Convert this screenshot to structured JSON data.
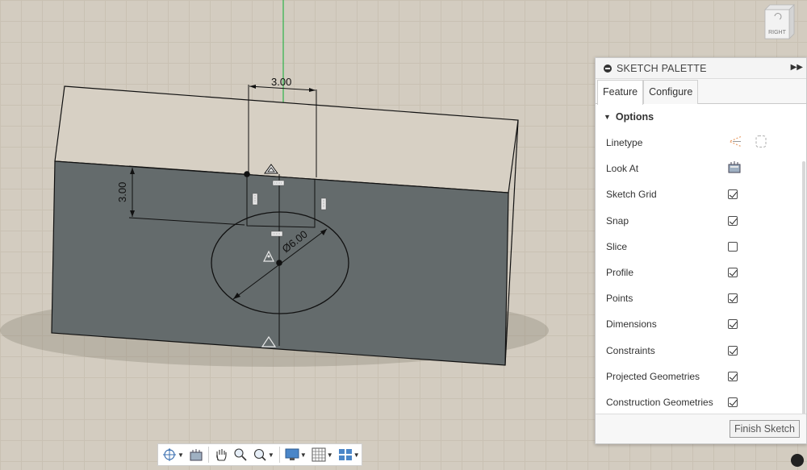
{
  "viewcube": {
    "face_label": "RIGHT"
  },
  "sketch": {
    "dimensions": {
      "width_label": "3.00",
      "height_label": "3.00",
      "diameter_label": "Ø6.00"
    }
  },
  "palette": {
    "title": "SKETCH PALETTE",
    "tabs": [
      {
        "label": "Feature",
        "active": true
      },
      {
        "label": "Configure",
        "active": false
      }
    ],
    "section_title": "Options",
    "options": [
      {
        "label": "Linetype",
        "control": "icons",
        "icons": [
          "construction-line-icon",
          "centerline-icon"
        ]
      },
      {
        "label": "Look At",
        "control": "icon",
        "icons": [
          "look-at-icon"
        ]
      },
      {
        "label": "Sketch Grid",
        "control": "checkbox",
        "checked": true
      },
      {
        "label": "Snap",
        "control": "checkbox",
        "checked": true
      },
      {
        "label": "Slice",
        "control": "checkbox",
        "checked": false
      },
      {
        "label": "Profile",
        "control": "checkbox",
        "checked": true
      },
      {
        "label": "Points",
        "control": "checkbox",
        "checked": true
      },
      {
        "label": "Dimensions",
        "control": "checkbox",
        "checked": true
      },
      {
        "label": "Constraints",
        "control": "checkbox",
        "checked": true
      },
      {
        "label": "Projected Geometries",
        "control": "checkbox",
        "checked": true
      },
      {
        "label": "Construction Geometries",
        "control": "checkbox",
        "checked": true
      }
    ],
    "finish_label": "Finish Sketch"
  },
  "navbar": {
    "tools": [
      "orbit-icon",
      "look-at-icon",
      "pan-icon",
      "zoom-icon",
      "zoom-window-icon",
      "display-settings-icon",
      "grid-settings-icon",
      "viewports-icon"
    ]
  },
  "colors": {
    "face_shade": "#646b6c",
    "background": "#d3ccc0",
    "axis_green": "#2fb34a"
  }
}
